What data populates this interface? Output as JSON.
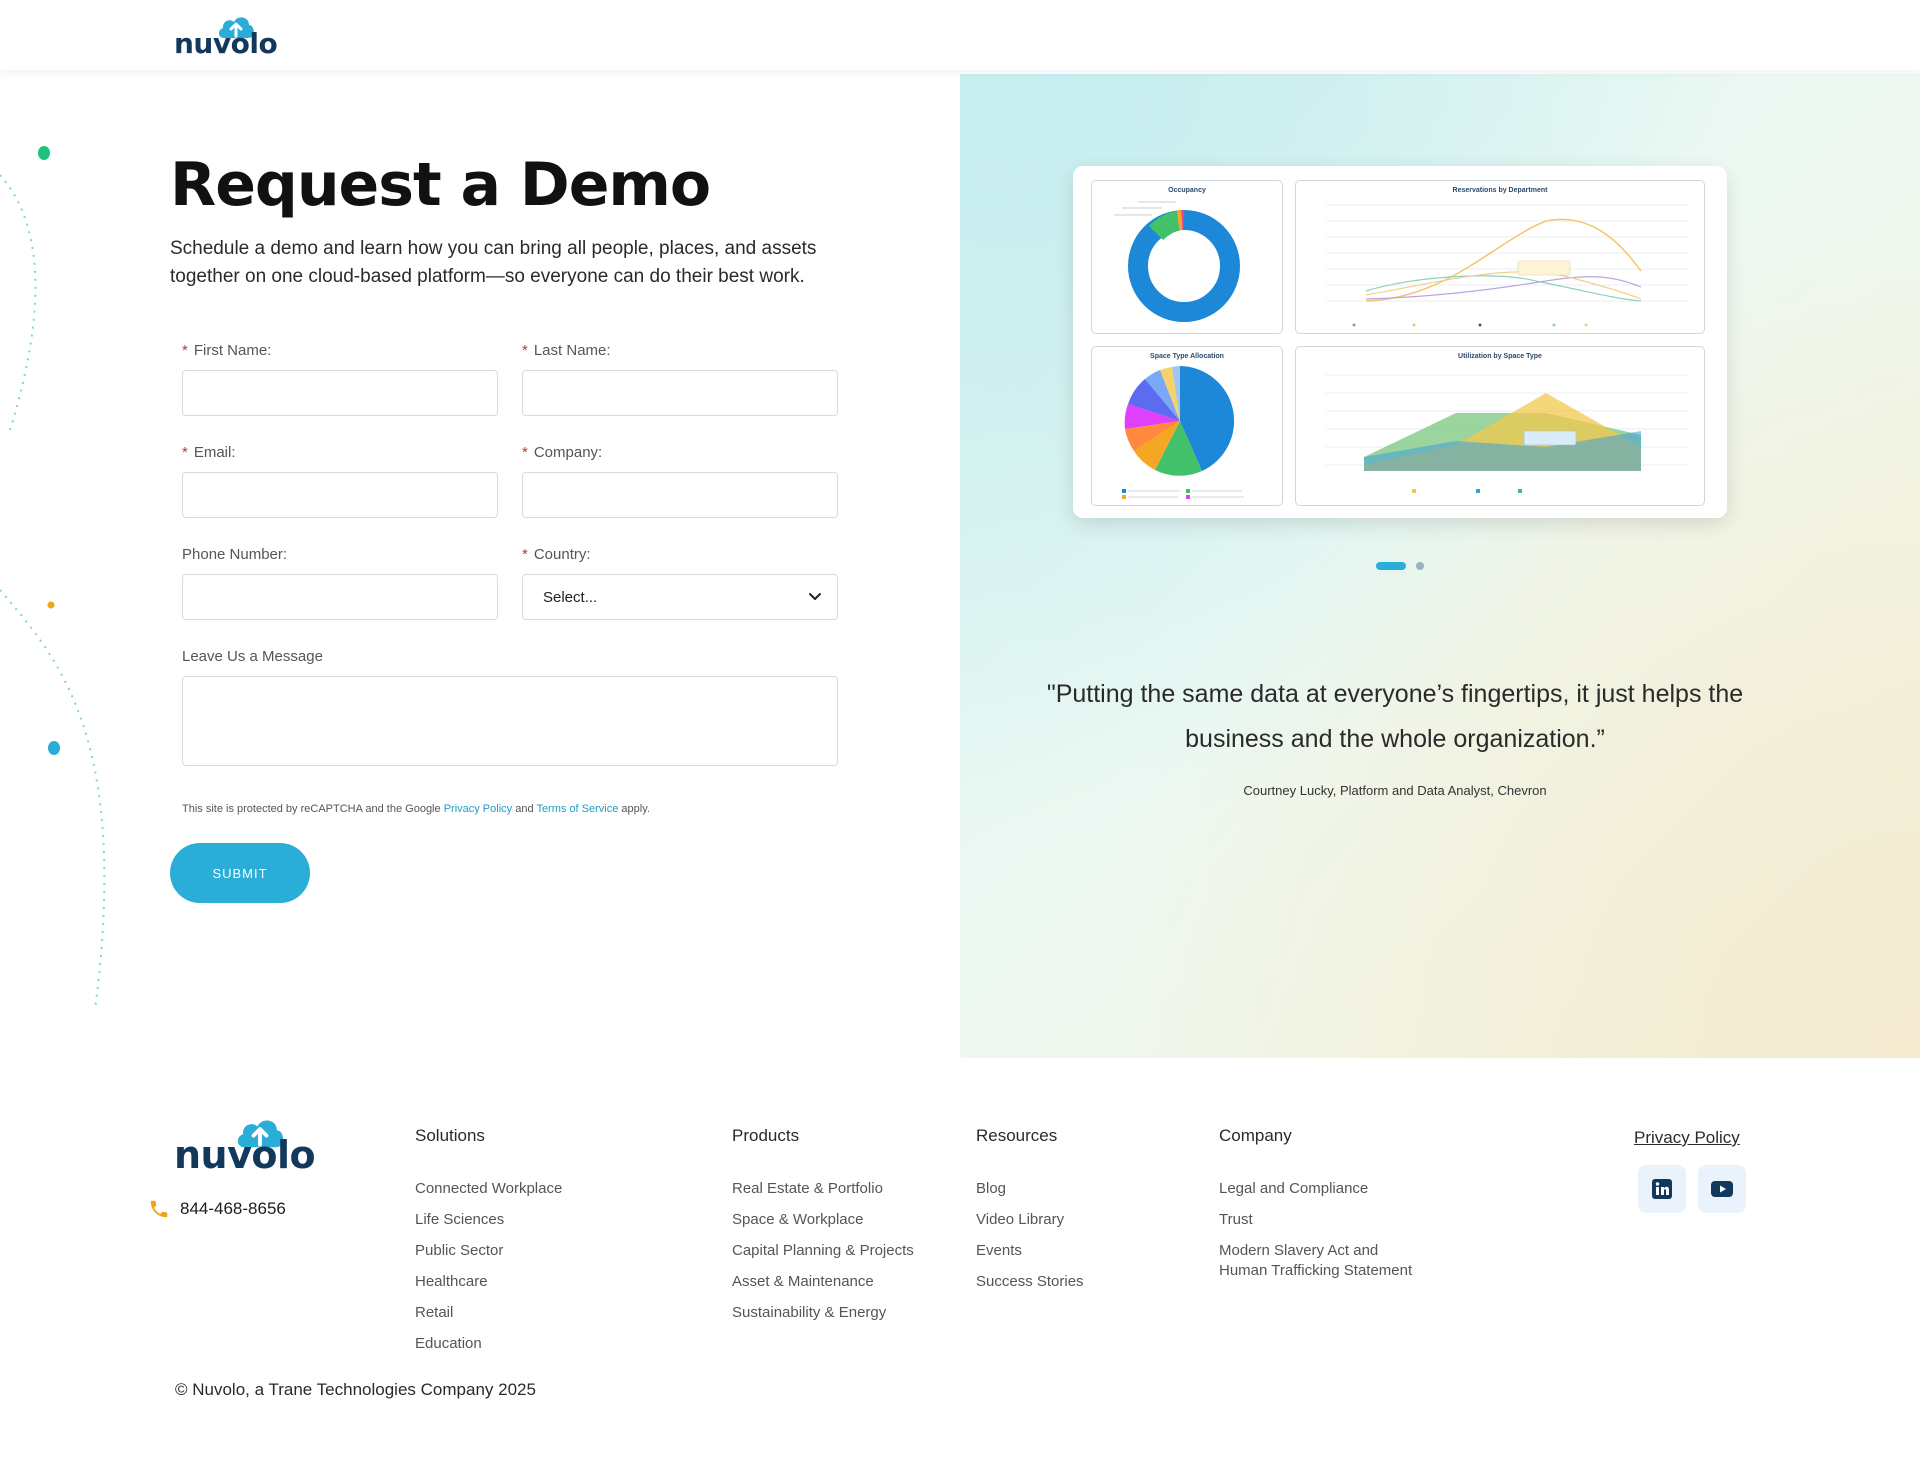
{
  "brand": {
    "name": "nuvolo",
    "primary": "#2aaed8",
    "navy": "#12385c"
  },
  "form": {
    "title": "Request a Demo",
    "subtitle": "Schedule a demo and learn how you can bring all people, places, and assets together on one cloud-based platform—so everyone can do their best work.",
    "required_marker": "*",
    "first_name_label": "First Name:",
    "last_name_label": "Last Name:",
    "email_label": "Email:",
    "company_label": "Company:",
    "phone_label": "Phone Number:",
    "country_label": "Country:",
    "country_value": "Select...",
    "message_label": "Leave Us a Message",
    "recaptcha_prefix": "This site is protected by reCAPTCHA and the Google ",
    "privacy_link": "Privacy Policy",
    "recaptcha_and": " and ",
    "terms_link": "Terms of Service",
    "recaptcha_suffix": " apply.",
    "submit_label": "SUBMIT"
  },
  "dashboard": {
    "occupancy_title": "Occupancy",
    "reservations_title": "Reservations by Department",
    "space_allocation_title": "Space Type Allocation",
    "utilization_title": "Utilization by Space Type"
  },
  "testimonial": {
    "quote": "\"Putting the same data at everyone’s fingertips, it just helps the business and the whole organization.”",
    "author": "Courtney Lucky, Platform and Data Analyst, Chevron"
  },
  "footer": {
    "phone": "844-468-8656",
    "columns": [
      {
        "heading": "Solutions",
        "items": [
          "Connected Workplace",
          "Life Sciences",
          "Public Sector",
          "Healthcare",
          "Retail",
          "Education"
        ]
      },
      {
        "heading": "Products",
        "items": [
          "Real Estate & Portfolio",
          "Space & Workplace",
          "Capital Planning & Projects",
          "Asset & Maintenance",
          "Sustainability & Energy"
        ]
      },
      {
        "heading": "Resources",
        "items": [
          "Blog",
          "Video Library",
          "Events",
          "Success Stories"
        ]
      },
      {
        "heading": "Company",
        "items": [
          "Legal and Compliance",
          "Trust",
          "Modern Slavery Act and",
          "Human Trafficking Statement"
        ]
      }
    ],
    "privacy_policy": "Privacy Policy",
    "social": [
      "linkedin-icon",
      "youtube-icon"
    ],
    "copyright": "© Nuvolo, a Trane Technologies Company 2025"
  }
}
